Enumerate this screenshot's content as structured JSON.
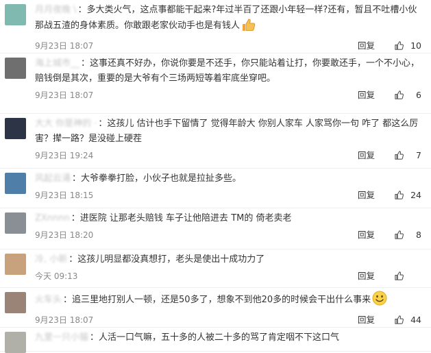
{
  "comments": [
    {
      "user": "月月夜晚 \\",
      "text": "多大类火气，这点事都能干起来?年过半百了还跟小年轻一样?还有，暂且不吐槽小伙那战五渣的身体素质。你敢跟老家伙动手也是有钱人",
      "emoji": "thumbs-up-emoji",
      "time": "9月23日 18:07",
      "reply": "回复",
      "likes": "10",
      "avatar_color": "#7fb9b0"
    },
    {
      "user": "海上城市__",
      "text": "这事还真不好办，你说你要是不还手，你只能站着让打，你要敢还手，一个不小心，赔钱倒是其次，重要的是大爷有个三场两短等着牢底坐穿吧。",
      "time": "9月23日 18:07",
      "reply": "回复",
      "likes": "6",
      "avatar_color": "#6f6f6f"
    },
    {
      "user": "大大 你是神的 ·",
      "text": "这孩儿 估计也手下留情了 觉得年龄大 你别人家车 人家骂你一句 咋了 都这么厉害？撵一路？是没碰上硬茬",
      "time": "9月23日 19:24",
      "reply": "回复",
      "likes": "7",
      "avatar_color": "#2c3445"
    },
    {
      "user": "风起云涌",
      "text": "大爷拳拳打脸，小伙子也就是拉扯多些。",
      "time": "9月23日 18:15",
      "reply": "回复",
      "likes": "24",
      "avatar_color": "#4f7fa8"
    },
    {
      "user": "ZXnnnn",
      "text": "进医院   让那老头赔钱  车子让他陪进去   TM的     倚老卖老",
      "time": "9月23日 18:20",
      "reply": "回复",
      "likes": "8",
      "avatar_color": "#8a8f96"
    },
    {
      "user": "冷, 小新",
      "text": "这孩儿明显都没真想打，老头是使出十成功力了",
      "time": "今天 09:13",
      "reply": "回复",
      "likes": "",
      "avatar_color": "#c7a27c"
    },
    {
      "user": "火车头",
      "text": "追三里地打别人一顿，还是50多了，想象不到他20多的时候会干出什么事来",
      "emoji": "smile-emoji",
      "time": "9月23日 18:07",
      "reply": "回复",
      "likes": "44",
      "avatar_color": "#9a8478"
    },
    {
      "user": "九里一只小猫",
      "text": "人活一口气嘛，五十多的人被二十多的骂了肯定咽不下这口气",
      "time": "",
      "reply": "",
      "likes": "",
      "avatar_color": "#b0b0a8"
    }
  ]
}
